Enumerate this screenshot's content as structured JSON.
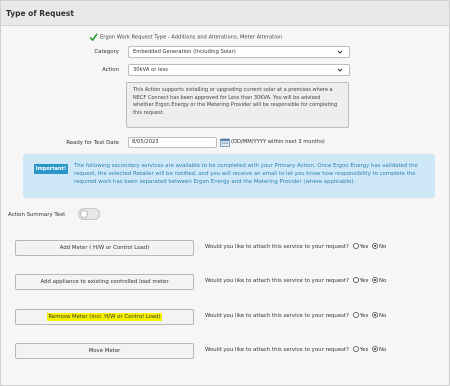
{
  "panel": {
    "title": "Type of Request"
  },
  "request_type": {
    "text": "Ergon Work Request Type - Additions and Alterations, Meter Alteration"
  },
  "category": {
    "label": "Category",
    "value": "Embedded Generation (Including Solar)"
  },
  "action": {
    "label": "Action",
    "value": "30kVA or less"
  },
  "info": {
    "text": "This Action supports installing or upgrading current solar at a premises where a NECF Connect has been approved for Less than 30KVA. You will be advised whether Ergon Energy or the Metering Provider will be responsible for completing this request."
  },
  "ready_date": {
    "label": "Ready for Test Date",
    "value": "8/05/2023",
    "hint": "(DD/MM/YYYY within next 3 months)"
  },
  "important": {
    "badge": "Important!",
    "text": "The following secondary services are available to be completed with your Primary Action. Once Ergon Energy has validated the request, the selected Retailer will be notified, and you will receive an email to let you know how responsibility to complete the required work has been separated between Ergon Energy and the Metering Provider (where applicable)."
  },
  "summary_toggle": {
    "label": "Action Summary Text",
    "state": "off"
  },
  "services": [
    {
      "button": "Add Meter ( H/W or Control Load)",
      "question": "Would you like to attach this service to your request?",
      "yes": "Yes",
      "no": "No",
      "selected": "No"
    },
    {
      "button": "Add appliance to existing controlled load meter",
      "question": "Would you like to attach this service to your request?",
      "yes": "Yes",
      "no": "No",
      "selected": "No"
    },
    {
      "button": "Remove Meter (incl. H/W or Control Load)",
      "question": "Would you like to attach this service to your request?",
      "yes": "Yes",
      "no": "No",
      "selected": "No",
      "highlight": "#f6f000"
    },
    {
      "button": "Move Meter",
      "question": "Would you like to attach this service to your request?",
      "yes": "Yes",
      "no": "No",
      "selected": "No"
    }
  ],
  "colors": {
    "accent": "#2b95c9",
    "important_bg": "#cfe8f7",
    "check": "#2e9c3a"
  }
}
